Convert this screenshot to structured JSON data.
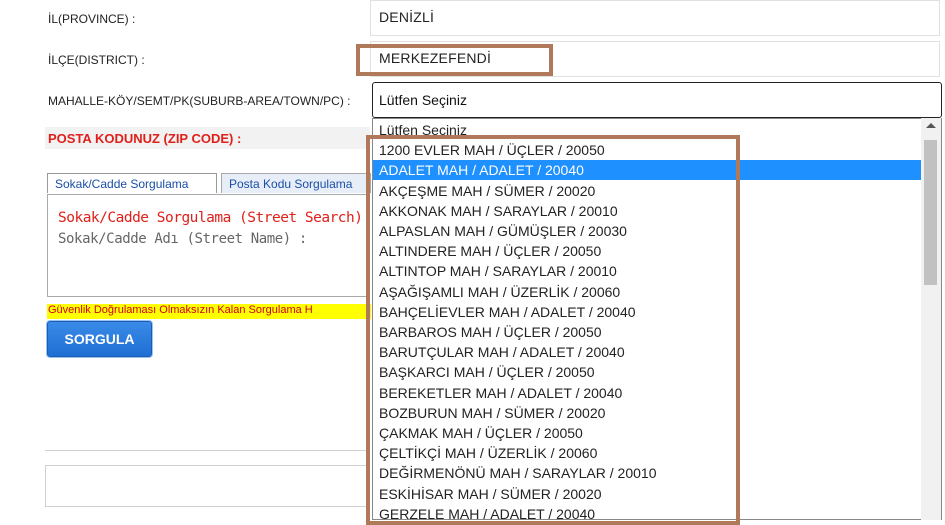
{
  "form": {
    "province_label": "İL(PROVINCE) :",
    "province_value": "DENİZLİ",
    "district_label": "İLÇE(DISTRICT) :",
    "district_value": "MERKEZEFENDİ",
    "suburb_label": "MAHALLE-KÖY/SEMT/PK(SUBURB-AREA/TOWN/PC) :",
    "suburb_value": "Lütfen Seçiniz",
    "zip_label": "POSTA KODUNUZ (ZIP CODE) :"
  },
  "tabs": [
    {
      "label": "Sokak/Cadde Sorgulama"
    },
    {
      "label": "Posta Kodu Sorgulama"
    }
  ],
  "panel": {
    "heading": "Sokak/Cadde Sorgulama (Street Search)",
    "field_label": "Sokak/Cadde Adı (Street Name) :"
  },
  "warning": "Güvenlik Doğrulaması Olmaksızın Kalan Sorgulama H",
  "button_label": "SORGULA",
  "dropdown": {
    "options": [
      "Lütfen Seçiniz",
      "1200 EVLER MAH / ÜÇLER / 20050",
      "ADALET MAH / ADALET / 20040",
      "AKÇEŞME MAH / SÜMER / 20020",
      "AKKONAK MAH / SARAYLAR / 20010",
      "ALPASLAN MAH / GÜMÜŞLER / 20030",
      "ALTINDERE MAH / ÜÇLER / 20050",
      "ALTINTOP MAH / SARAYLAR / 20010",
      "AŞAĞIŞAMLI MAH / ÜZERLİK / 20060",
      "BAHÇELİEVLER MAH / ADALET / 20040",
      "BARBAROS MAH / ÜÇLER / 20050",
      "BARUTÇULAR MAH / ADALET / 20040",
      "BAŞKARCI MAH / ÜÇLER / 20050",
      "BEREKETLER MAH / ADALET / 20040",
      "BOZBURUN MAH / SÜMER / 20020",
      "ÇAKMAK MAH / ÜÇLER / 20050",
      "ÇELTİKÇİ MAH / ÜZERLİK / 20060",
      "DEĞİRMENÖNÜ MAH / SARAYLAR / 20010",
      "ESKİHİSAR MAH / SÜMER / 20020",
      "GERZELE MAH / ADALET / 20040"
    ],
    "selected_index": 2
  },
  "colors": {
    "highlight": "#b07a5a",
    "selected_bg": "#1e90ff",
    "zip_label": "#e0201a",
    "warning_bg": "#ffff00"
  }
}
